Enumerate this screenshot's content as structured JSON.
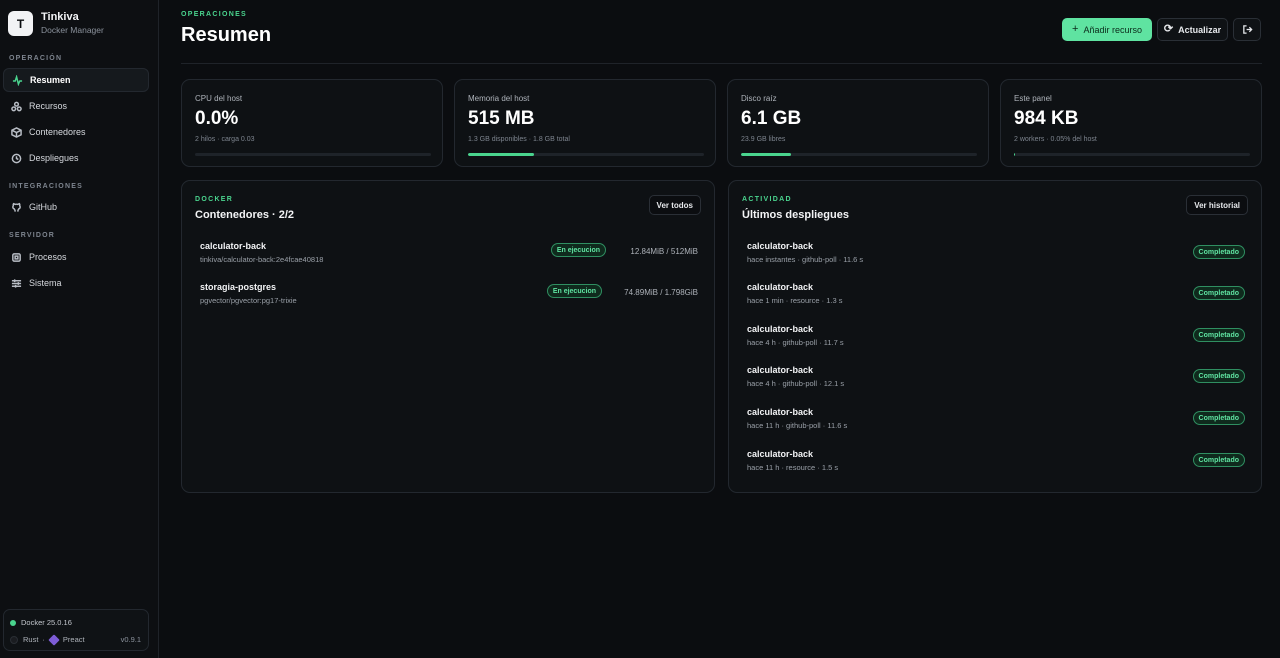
{
  "brand": {
    "logo": "T",
    "name": "Tinkiva",
    "subtitle": "Docker Manager"
  },
  "sidebar": {
    "sections": [
      {
        "label": "OPERACIÓN"
      },
      {
        "label": "INTEGRACIONES"
      },
      {
        "label": "SERVIDOR"
      }
    ],
    "items": [
      {
        "label": "Resumen",
        "icon": "activity-icon",
        "active": true
      },
      {
        "label": "Recursos",
        "icon": "resources-icon"
      },
      {
        "label": "Contenedores",
        "icon": "box-icon"
      },
      {
        "label": "Despliegues",
        "icon": "history-icon"
      },
      {
        "label": "GitHub",
        "icon": "github-icon"
      },
      {
        "label": "Procesos",
        "icon": "processes-icon"
      },
      {
        "label": "Sistema",
        "icon": "sliders-icon"
      }
    ],
    "footer": {
      "docker": "Docker 25.0.16",
      "rust": "Rust",
      "sep": "·",
      "preact": "Preact",
      "version": "v0.9.1"
    }
  },
  "header": {
    "eyebrow": "OPERACIONES",
    "title": "Resumen",
    "add_label": "Añadir recurso",
    "refresh_label": "Actualizar"
  },
  "stats": [
    {
      "label": "CPU del host",
      "value": "0.0%",
      "sub": "2 hilos · carga 0.03",
      "fill": 0
    },
    {
      "label": "Memoria del host",
      "value": "515 MB",
      "sub": "1.3 GB disponibles · 1.8 GB total",
      "fill": 0.28
    },
    {
      "label": "Disco raíz",
      "value": "6.1 GB",
      "sub": "23.9 GB libres",
      "fill": 0.21
    },
    {
      "label": "Este panel",
      "value": "984 KB",
      "sub": "2 workers · 0.05% del host",
      "fill": 0.005
    }
  ],
  "containers_panel": {
    "eyebrow": "DOCKER",
    "title": "Contenedores · 2/2",
    "button": "Ver todos",
    "items": [
      {
        "name": "calculator-back",
        "image": "tinkiva/calculator-back:2e4fcae40818",
        "status": "En ejecucion",
        "mem": "12.84MiB / 512MiB"
      },
      {
        "name": "storagia-postgres",
        "image": "pgvector/pgvector:pg17-trixie",
        "status": "En ejecucion",
        "mem": "74.89MiB / 1.798GiB"
      }
    ]
  },
  "deploys_panel": {
    "eyebrow": "ACTIVIDAD",
    "title": "Últimos despliegues",
    "button": "Ver historial",
    "items": [
      {
        "name": "calculator-back",
        "meta": "hace instantes · github-poll · 11.6 s",
        "status": "Completado"
      },
      {
        "name": "calculator-back",
        "meta": "hace 1 min · resource · 1.3 s",
        "status": "Completado"
      },
      {
        "name": "calculator-back",
        "meta": "hace 4 h · github-poll · 11.7 s",
        "status": "Completado"
      },
      {
        "name": "calculator-back",
        "meta": "hace 4 h · github-poll · 12.1 s",
        "status": "Completado"
      },
      {
        "name": "calculator-back",
        "meta": "hace 11 h · github-poll · 11.6 s",
        "status": "Completado"
      },
      {
        "name": "calculator-back",
        "meta": "hace 11 h · resource · 1.5 s",
        "status": "Completado"
      }
    ]
  },
  "colors": {
    "accent": "#4ad48e",
    "button_primary": "#5fe3a1",
    "background": "#0b0d10",
    "card": "#0e1114"
  }
}
